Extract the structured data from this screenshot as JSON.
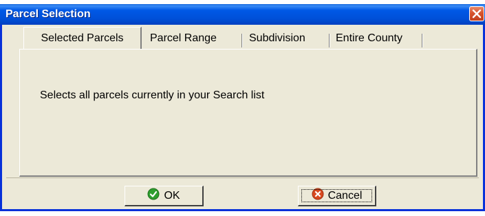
{
  "window": {
    "title": "Parcel Selection",
    "close_icon": "close-icon",
    "titlebar_color": "#0058e6"
  },
  "tabs": [
    {
      "label": "Selected Parcels",
      "active": true
    },
    {
      "label": "Parcel Range",
      "active": false
    },
    {
      "label": "Subdivision",
      "active": false
    },
    {
      "label": "Entire County",
      "active": false
    }
  ],
  "panel": {
    "description": "Selects all parcels currently in your Search list"
  },
  "buttons": {
    "ok": {
      "label": "OK",
      "icon": "check-icon",
      "icon_color": "#2e9e2e"
    },
    "cancel": {
      "label": "Cancel",
      "icon": "cancel-icon",
      "icon_color": "#d84a20"
    }
  }
}
